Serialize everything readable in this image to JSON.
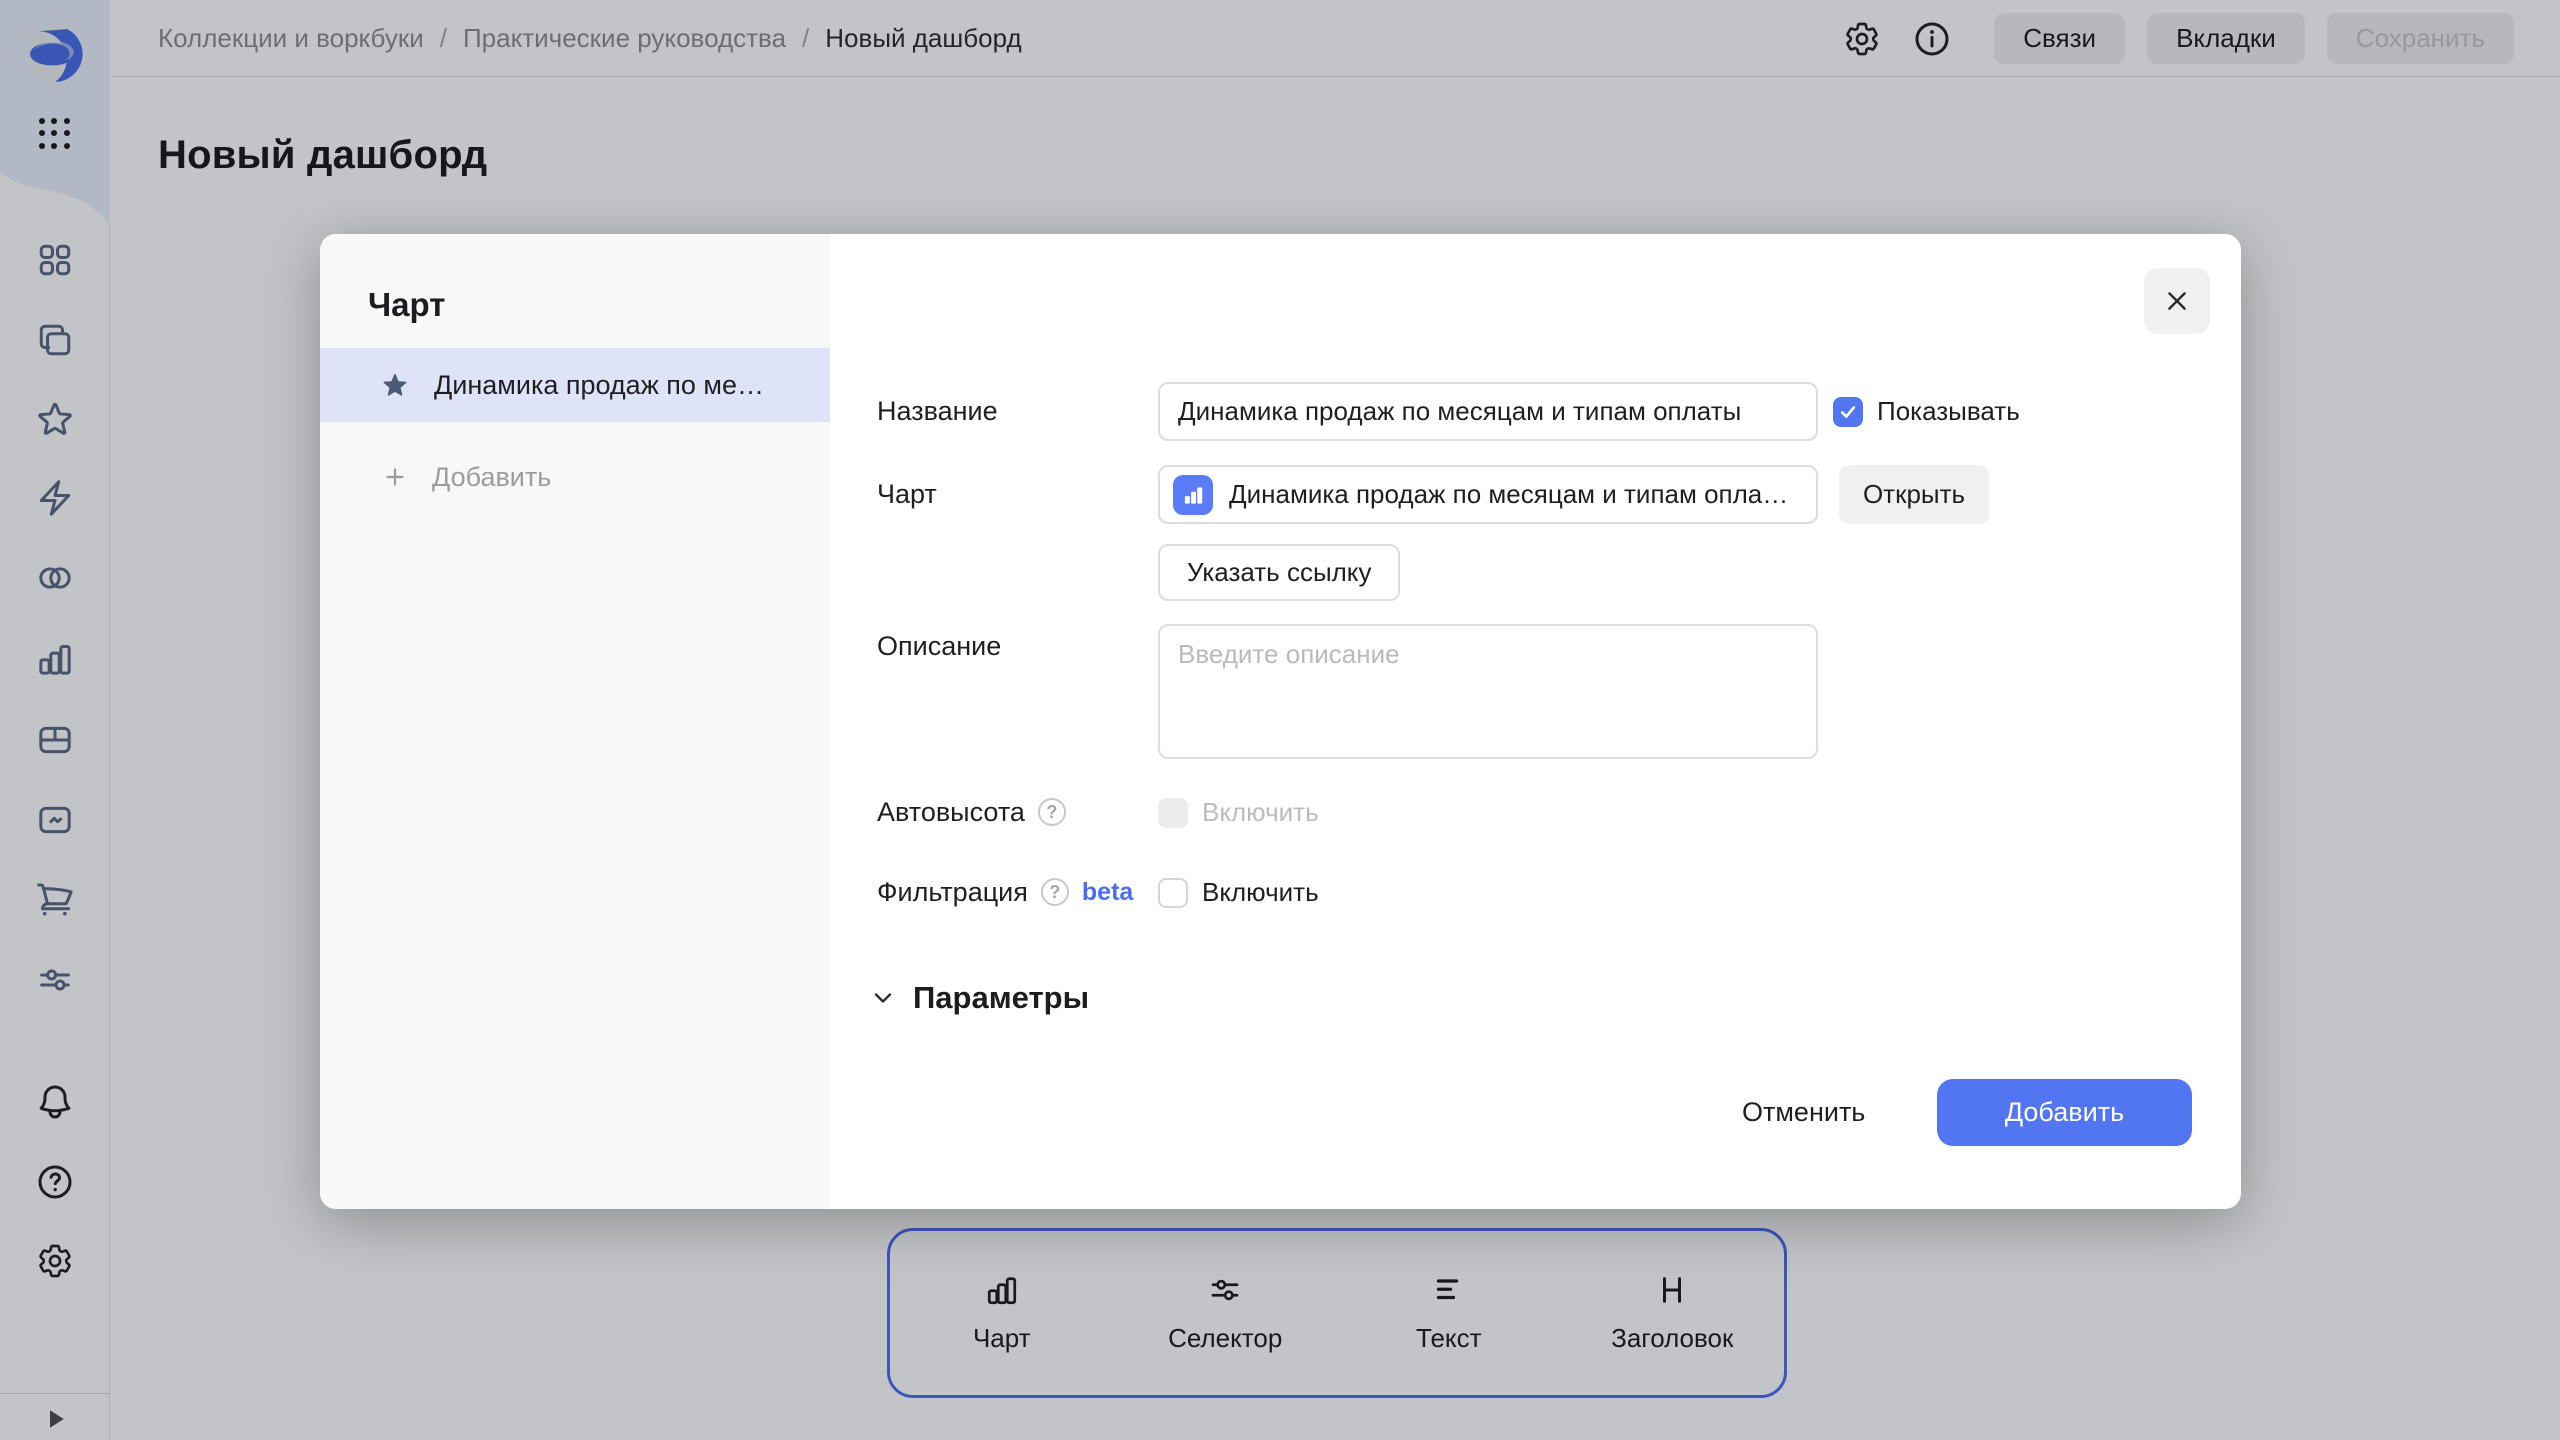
{
  "topbar": {
    "breadcrumb": {
      "items": [
        "Коллекции и воркбуки",
        "Практические руководства",
        "Новый дашборд"
      ],
      "separator": "/"
    },
    "actions": {
      "links": "Связи",
      "tabs": "Вкладки",
      "save": "Сохранить"
    }
  },
  "page": {
    "title": "Новый дашборд"
  },
  "sidebar": {
    "icons": [
      "datalens-logo",
      "apps-grid",
      "dashboards-grid",
      "collections-stack",
      "favorites-star",
      "editor-bolt",
      "connections-circles",
      "charts-bars",
      "tables-grid",
      "files-folder",
      "marketplace-cart",
      "services-sliders",
      "notifications-bell",
      "help-circle",
      "settings-gear",
      "expand-arrow"
    ]
  },
  "dialog": {
    "panel": {
      "title": "Чарт",
      "selected_item": "Динамика продаж по ме…",
      "add": "Добавить"
    },
    "fields": {
      "name": {
        "label": "Название",
        "value": "Динамика продаж по месяцам и типам оплаты"
      },
      "show": {
        "label": "Показывать",
        "checked": true
      },
      "chart": {
        "label": "Чарт",
        "value": "Динамика продаж по месяцам и типам опла…",
        "open": "Открыть",
        "set_link": "Указать ссылку"
      },
      "description": {
        "label": "Описание",
        "placeholder": "Введите описание",
        "value": ""
      },
      "autoheight": {
        "label": "Автовысота",
        "toggle": "Включить",
        "enabled": false,
        "checked": false
      },
      "filtering": {
        "label": "Фильтрация",
        "badge": "beta",
        "toggle": "Включить",
        "checked": false
      },
      "parameters": {
        "label": "Параметры"
      }
    },
    "footer": {
      "cancel": "Отменить",
      "submit": "Добавить"
    }
  },
  "edit_toolbar": {
    "items": [
      {
        "icon": "chart-icon",
        "label": "Чарт"
      },
      {
        "icon": "selector-icon",
        "label": "Селектор"
      },
      {
        "icon": "text-icon",
        "label": "Текст"
      },
      {
        "icon": "heading-icon",
        "label": "Заголовок"
      }
    ]
  },
  "colors": {
    "accent": "#5276f2",
    "selection_bg": "#dfe3f8",
    "beta": "#4a6df2",
    "toolbar_border": "#4f6ef2"
  }
}
